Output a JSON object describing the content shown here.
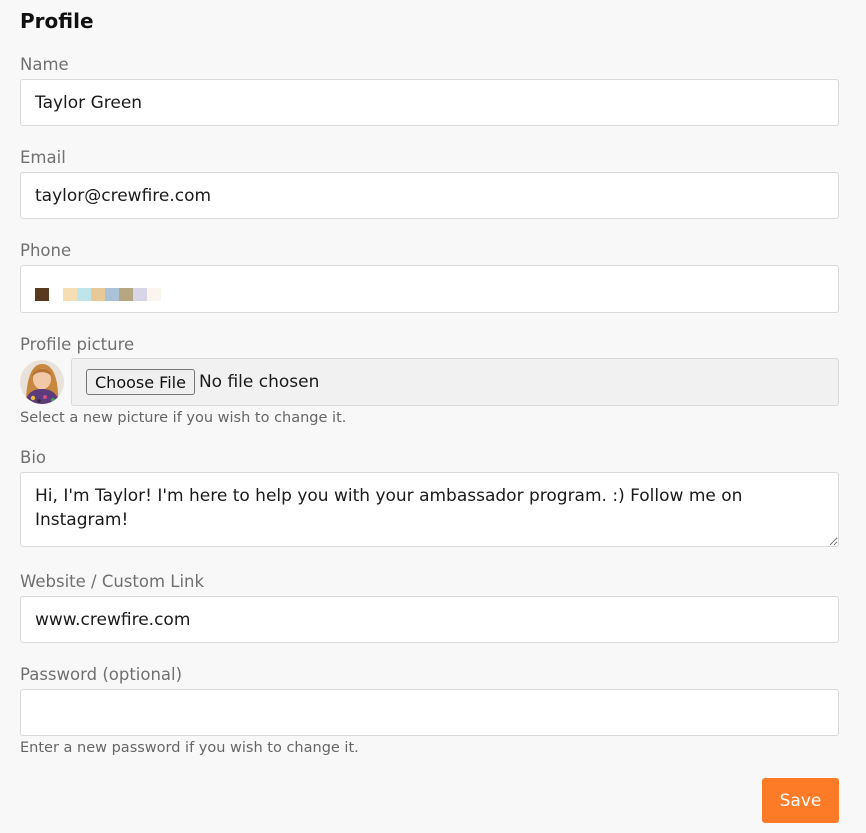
{
  "page": {
    "title": "Profile"
  },
  "name": {
    "label": "Name",
    "value": "Taylor Green"
  },
  "email": {
    "label": "Email",
    "value": "taylor@crewfire.com"
  },
  "phone": {
    "label": "Phone",
    "redacted_colors": [
      "#5a3a1e",
      "#ffffff",
      "#f6deb4",
      "#bfe4ea",
      "#e7c896",
      "#a9c2d6",
      "#b4a781",
      "#d7d5e6",
      "#fbf5ef"
    ]
  },
  "picture": {
    "label": "Profile picture",
    "button_label": "Choose File",
    "file_status": "No file chosen",
    "help": "Select a new picture if you wish to change it."
  },
  "bio": {
    "label": "Bio",
    "value": "Hi, I'm Taylor! I'm here to help you with your ambassador program. :) Follow me on Instagram!"
  },
  "website": {
    "label": "Website / Custom Link",
    "value": "www.crewfire.com"
  },
  "password": {
    "label": "Password (optional)",
    "value": "",
    "help": "Enter a new password if you wish to change it."
  },
  "actions": {
    "save_label": "Save",
    "accent": "#fd7b26"
  }
}
